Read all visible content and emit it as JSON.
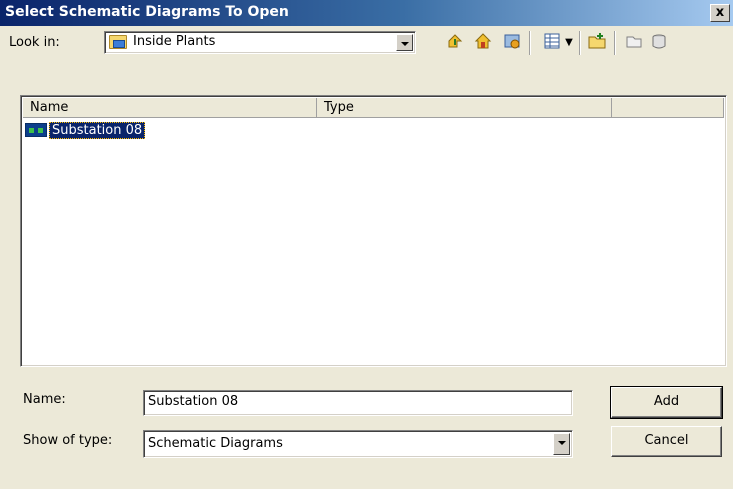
{
  "window": {
    "title": "Select Schematic Diagrams To Open",
    "close_label": "x"
  },
  "toolbar": {
    "lookin_label": "Look in:",
    "lookin_value": "Inside Plants",
    "icons": [
      "up-folder-icon",
      "home-icon",
      "recent-icon",
      "view-menu-icon",
      "new-folder-icon",
      "new-item-icon",
      "delete-icon"
    ]
  },
  "filelist": {
    "columns": [
      "Name",
      "Type"
    ],
    "items": [
      {
        "name": "Substation 08",
        "type": "",
        "selected": true
      }
    ]
  },
  "form": {
    "name_label": "Name:",
    "name_value": "Substation 08",
    "type_label": "Show of type:",
    "type_value": "Schematic Diagrams"
  },
  "buttons": {
    "add_label": "Add",
    "cancel_label": "Cancel"
  },
  "colors": {
    "title_start": "#0a246a",
    "title_end": "#a6caf0",
    "selection": "#0a246a",
    "dialog_bg": "#ece9d8"
  }
}
